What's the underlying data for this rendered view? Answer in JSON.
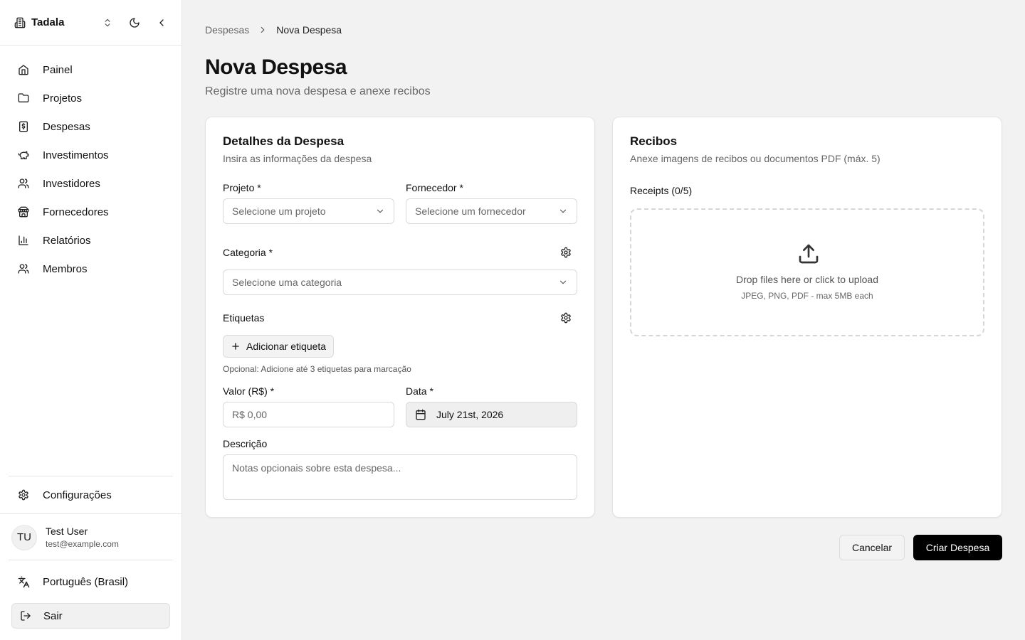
{
  "sidebar": {
    "brand": "Tadala",
    "nav": [
      {
        "label": "Painel",
        "icon": "home-icon"
      },
      {
        "label": "Projetos",
        "icon": "folder-icon"
      },
      {
        "label": "Despesas",
        "icon": "receipt-dollar-icon"
      },
      {
        "label": "Investimentos",
        "icon": "piggy-bank-icon"
      },
      {
        "label": "Investidores",
        "icon": "users-icon"
      },
      {
        "label": "Fornecedores",
        "icon": "store-icon"
      },
      {
        "label": "Relatórios",
        "icon": "bar-chart-icon"
      },
      {
        "label": "Membros",
        "icon": "users-icon"
      }
    ],
    "settings_label": "Configurações",
    "user": {
      "initials": "TU",
      "name": "Test User",
      "email": "test@example.com"
    },
    "language_label": "Português (Brasil)",
    "logout_label": "Sair"
  },
  "breadcrumb": {
    "parent": "Despesas",
    "current": "Nova Despesa"
  },
  "page": {
    "title": "Nova Despesa",
    "subtitle": "Registre uma nova despesa e anexe recibos"
  },
  "details": {
    "title": "Detalhes da Despesa",
    "description": "Insira as informações da despesa",
    "project": {
      "label": "Projeto *",
      "placeholder": "Selecione um projeto"
    },
    "supplier": {
      "label": "Fornecedor *",
      "placeholder": "Selecione um fornecedor"
    },
    "category": {
      "label": "Categoria *",
      "placeholder": "Selecione uma categoria"
    },
    "tags": {
      "label": "Etiquetas",
      "add_button": "Adicionar etiqueta",
      "hint": "Opcional: Adicione até 3 etiquetas para marcação"
    },
    "amount": {
      "label": "Valor (R$) *",
      "placeholder": "R$ 0,00"
    },
    "date": {
      "label": "Data *",
      "value": "July 21st, 2026"
    },
    "notes": {
      "label": "Descrição",
      "placeholder": "Notas opcionais sobre esta despesa..."
    }
  },
  "receipts": {
    "title": "Recibos",
    "description": "Anexe imagens de recibos ou documentos PDF (máx. 5)",
    "count_label": "Receipts (0/5)",
    "drop_main": "Drop files here or click to upload",
    "drop_sub": "JPEG, PNG, PDF - max 5MB each"
  },
  "actions": {
    "cancel": "Cancelar",
    "create": "Criar Despesa"
  }
}
